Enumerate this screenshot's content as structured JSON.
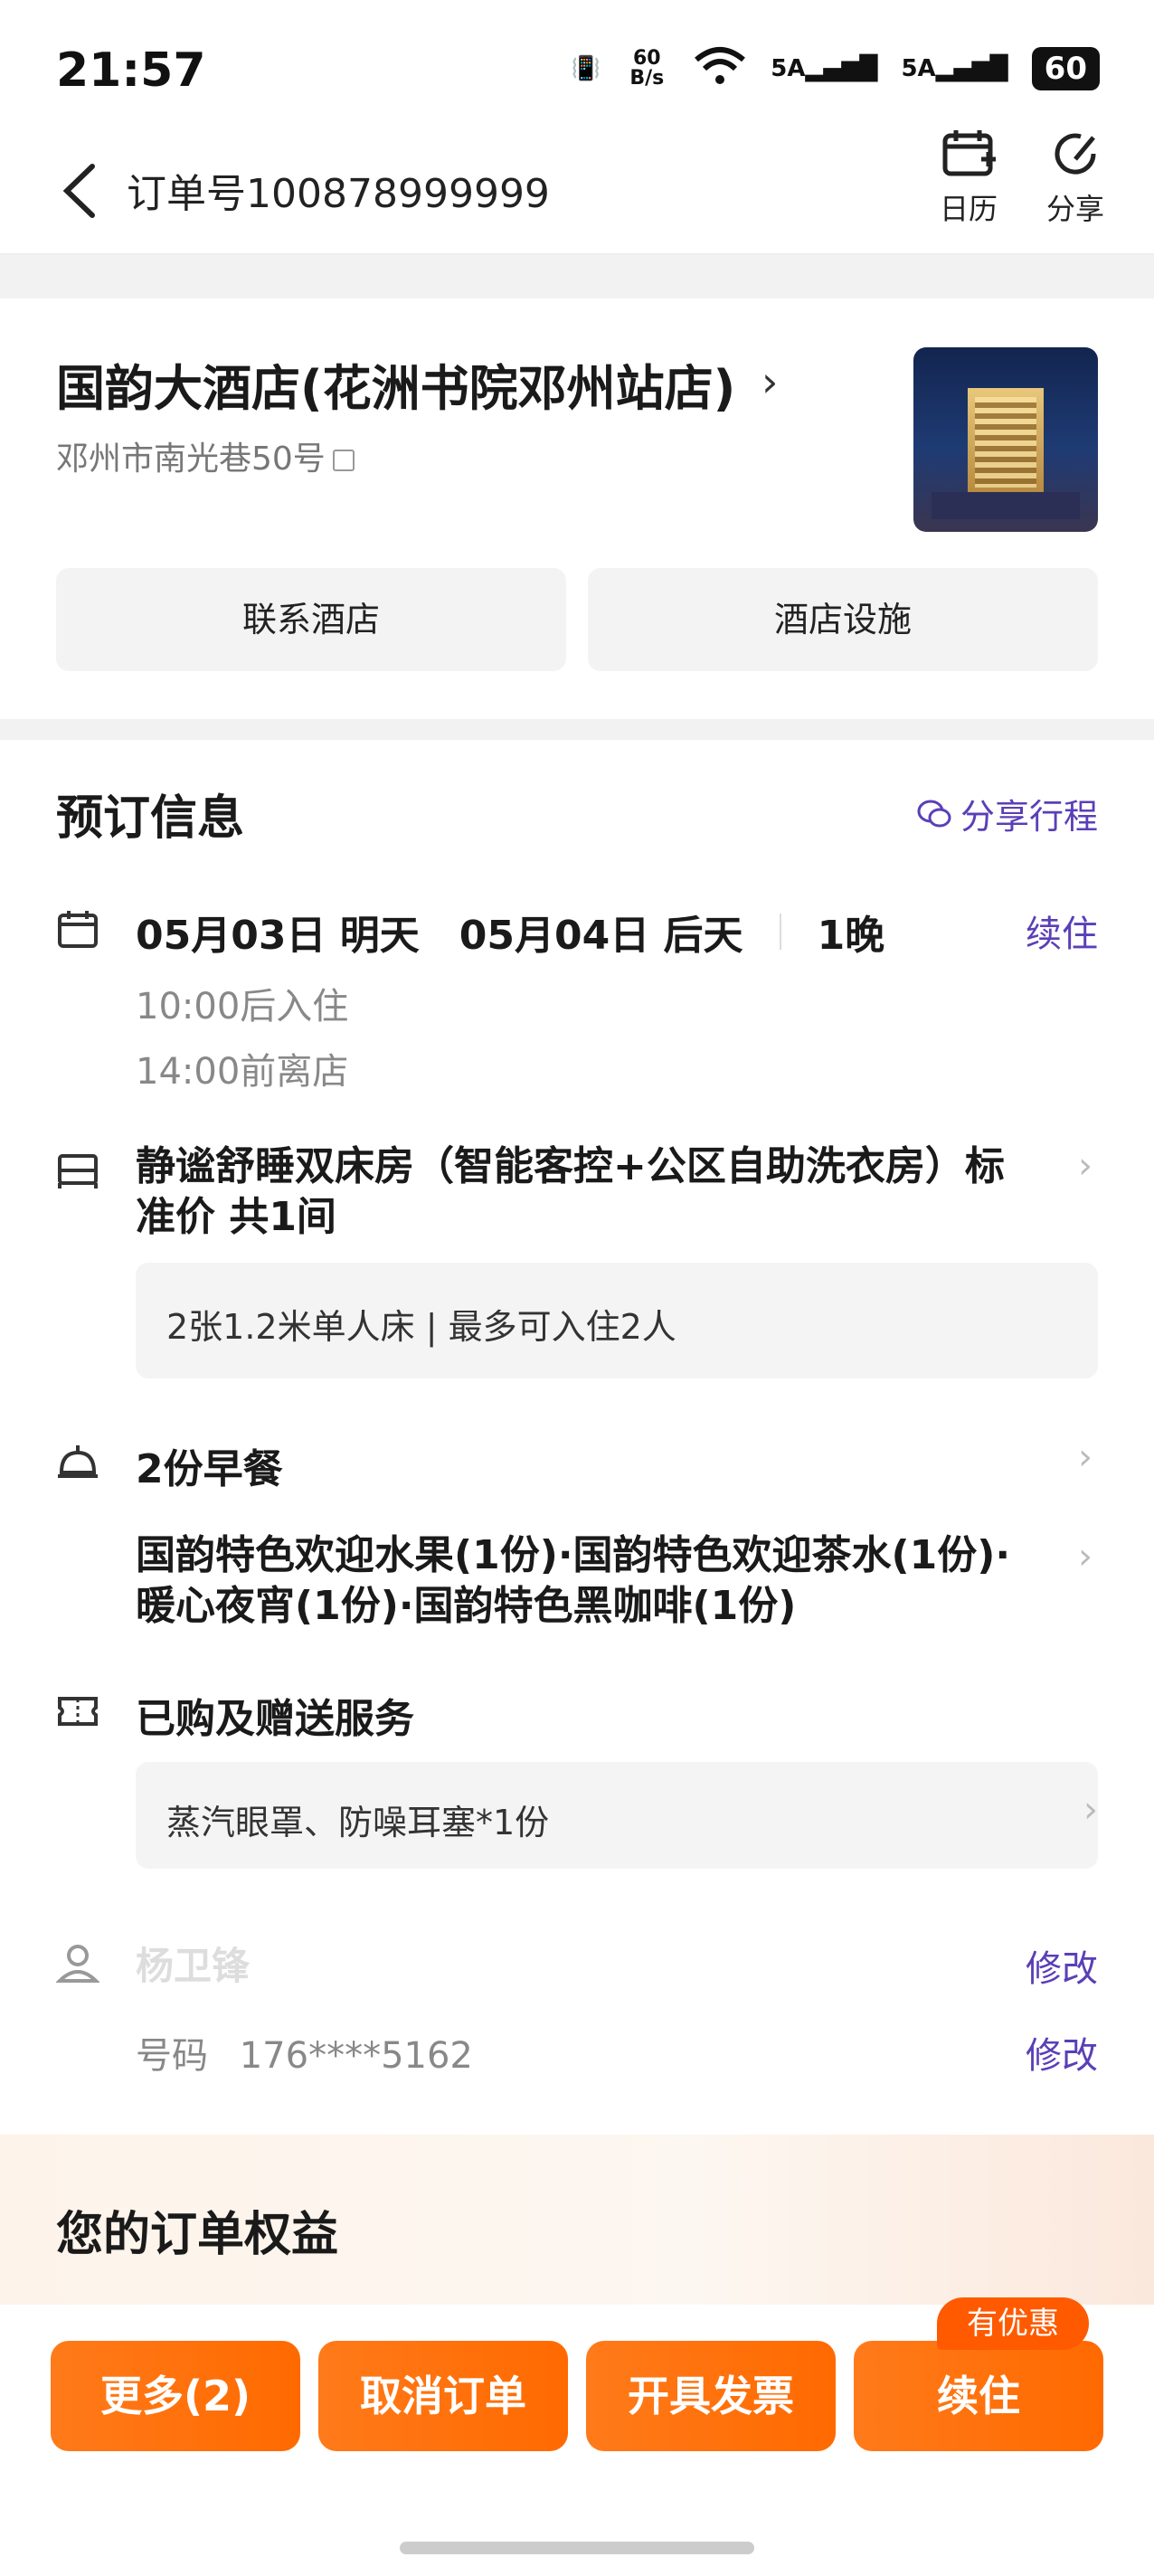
{
  "status_bar": {
    "time": "21:57",
    "net_speed": "60 B/s",
    "signal1": "5A",
    "signal2": "5A",
    "battery": "60"
  },
  "header": {
    "order_title": "订单号100878999999",
    "calendar_label": "日历",
    "share_label": "分享"
  },
  "hotel": {
    "name": "国韵大酒店(花洲书院邓州站店)",
    "address": "邓州市南光巷50号",
    "contact_button": "联系酒店",
    "facilities_button": "酒店设施"
  },
  "booking": {
    "section_title": "预订信息",
    "share_trip": "分享行程",
    "checkin_date": "05月03日 明天",
    "checkout_date": "05月04日 后天",
    "nights": "1晚",
    "renew_link": "续住",
    "checkin_time": "10:00后入住",
    "checkout_time": "14:00前离店",
    "room_name": "静谧舒睡双床房（智能客控+公区自助洗衣房）标准价 共1间",
    "bed_info": "2张1.2米单人床 | 最多可入住2人",
    "breakfast": "2份早餐",
    "amenities": "国韵特色欢迎水果(1份)·国韵特色欢迎茶水(1份)·暖心夜宵(1份)·国韵特色黑咖啡(1份)",
    "services_title": "已购及赠送服务",
    "services_detail": "蒸汽眼罩、防噪耳塞*1份",
    "guest_name": "杨卫锋",
    "edit_label": "修改",
    "phone_label": "号码",
    "phone_value": "176****5162",
    "phone_edit_label": "修改"
  },
  "benefits": {
    "title": "您的订单权益"
  },
  "bottom_bar": {
    "more_button": "更多(2)",
    "cancel_button": "取消订单",
    "invoice_button": "开具发票",
    "renew_button": "续住",
    "discount_tag": "有优惠"
  },
  "colors": {
    "accent_purple": "#5a3fb7",
    "button_orange": "#ff6a00"
  }
}
